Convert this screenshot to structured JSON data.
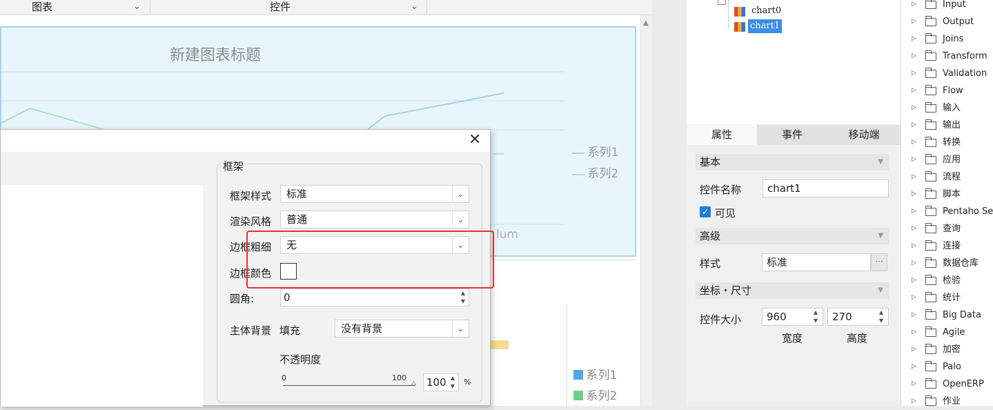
{
  "toolbar": {
    "chart_label": "图表",
    "control_label": "控件"
  },
  "chart1": {
    "title": "新建图表标题",
    "legend": [
      "系列1",
      "系列2"
    ],
    "axis_label_fragment": "lum",
    "series_colors": [
      "#9dd3f2",
      "#a9e2c5"
    ]
  },
  "chart2": {
    "legend": [
      "系列1",
      "系列2"
    ],
    "series_colors": [
      "#4ca8e8",
      "#6fd08c"
    ]
  },
  "dialog": {
    "group_title": "框架",
    "frame_style": {
      "label": "框架样式",
      "value": "标准"
    },
    "render_style": {
      "label": "渲染风格",
      "value": "普通"
    },
    "border_width": {
      "label": "边框粗细",
      "value": "无"
    },
    "border_color": {
      "label": "边框颜色"
    },
    "radius": {
      "label": "圆角:",
      "value": "0"
    },
    "background": {
      "label": "主体背景",
      "fill_label": "填充",
      "value": "没有背景"
    },
    "opacity": {
      "label": "不透明度",
      "min": "0",
      "max": "100",
      "value": "100",
      "unit": "%"
    }
  },
  "tree": {
    "items": [
      "chart0",
      "chart1"
    ]
  },
  "tabs": [
    "属性",
    "事件",
    "移动端"
  ],
  "props": {
    "basic": "基本",
    "name_label": "控件名称",
    "name_value": "chart1",
    "visible_label": "可见",
    "advanced": "高级",
    "style_label": "样式",
    "style_value": "标准",
    "coords": "坐标・尺寸",
    "size_label": "控件大小",
    "width_value": "960",
    "height_value": "270",
    "width_caption": "宽度",
    "height_caption": "高度"
  },
  "folders": [
    "Input",
    "Output",
    "Joins",
    "Transform",
    "Validation",
    "Flow",
    "输入",
    "输出",
    "转换",
    "应用",
    "流程",
    "脚本",
    "Pentaho Serv",
    "查询",
    "连接",
    "数据仓库",
    "检验",
    "统计",
    "Big Data",
    "Agile",
    "加密",
    "Palo",
    "OpenERP",
    "作业"
  ],
  "accent_red": "#e8302a"
}
